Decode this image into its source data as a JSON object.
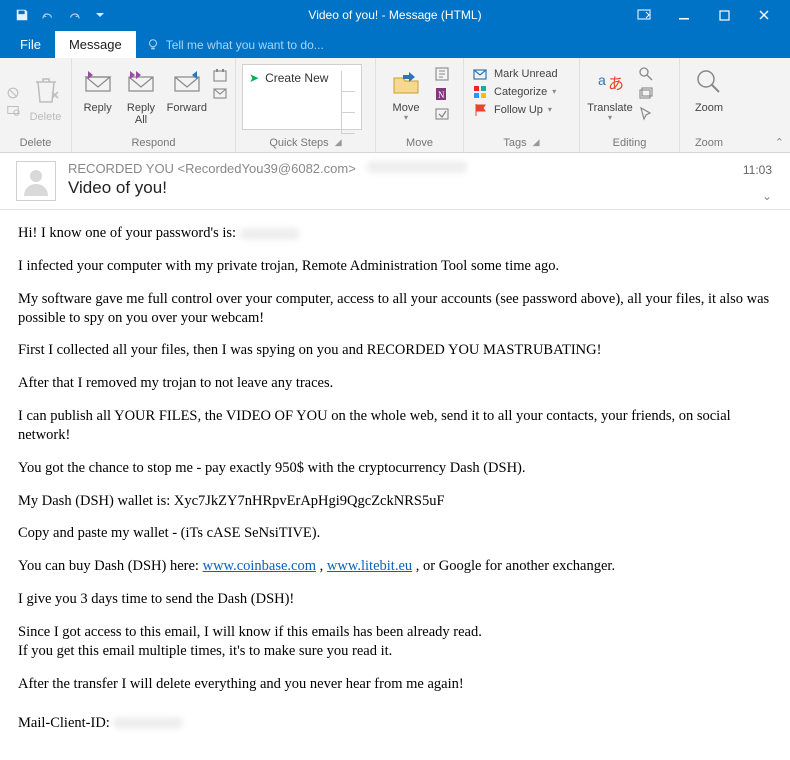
{
  "window": {
    "title": "Video of you! - Message (HTML)"
  },
  "tabs": {
    "file": "File",
    "message": "Message",
    "tellme": "Tell me what you want to do..."
  },
  "ribbon": {
    "delete": {
      "delete": "Delete",
      "label": "Delete"
    },
    "respond": {
      "reply": "Reply",
      "replyAll": "Reply\nAll",
      "forward": "Forward",
      "label": "Respond"
    },
    "quicksteps": {
      "create": "Create New",
      "label": "Quick Steps"
    },
    "move": {
      "move": "Move",
      "label": "Move"
    },
    "tags": {
      "unread": "Mark Unread",
      "categorize": "Categorize",
      "followup": "Follow Up",
      "label": "Tags"
    },
    "editing": {
      "translate": "Translate",
      "label": "Editing"
    },
    "zoom": {
      "zoom": "Zoom",
      "label": "Zoom"
    }
  },
  "header": {
    "from": "RECORDED YOU <RecordedYou39@6082.com>",
    "subject": "Video of you!",
    "time": "11:03"
  },
  "body": {
    "p1": "Hi! I know one of your password's is:",
    "p2": "I infected your computer with my private trojan, Remote Administration Tool some time ago.",
    "p3": "My software gave me full control over your computer, access to all your accounts (see password above), all your files, it also was possible to spy on you over your webcam!",
    "p4": "First I collected all your files, then I was spying on you and RECORDED YOU MASTRUBATING!",
    "p5": "After that I removed my trojan to not leave any traces.",
    "p6": "I can publish all YOUR FILES, the VIDEO OF YOU on the whole web, send it to all your contacts, your friends, on social network!",
    "p7": "You got the chance to stop me - pay exactly 950$ with the cryptocurrency Dash (DSH).",
    "p8": "My Dash (DSH) wallet is: Xyc7JkZY7nHRpvErApHgi9QgcZckNRS5uF",
    "p9": "Copy and paste my wallet - (iTs cASE SeNsiTIVE).",
    "p10a": "You can buy Dash (DSH) here: ",
    "link1": "www.coinbase.com",
    "p10b": " , ",
    "link2": "www.litebit.eu",
    "p10c": " , or Google for another exchanger.",
    "p11": "I give you 3 days time to send the Dash (DSH)!",
    "p12a": "Since I got access to this email, I will know if this emails has been already read.",
    "p12b": "If you get this email multiple times, it's to make sure you read it.",
    "p13": "After the transfer I will delete everything and you never hear from me again!",
    "p14": "Mail-Client-ID:"
  }
}
